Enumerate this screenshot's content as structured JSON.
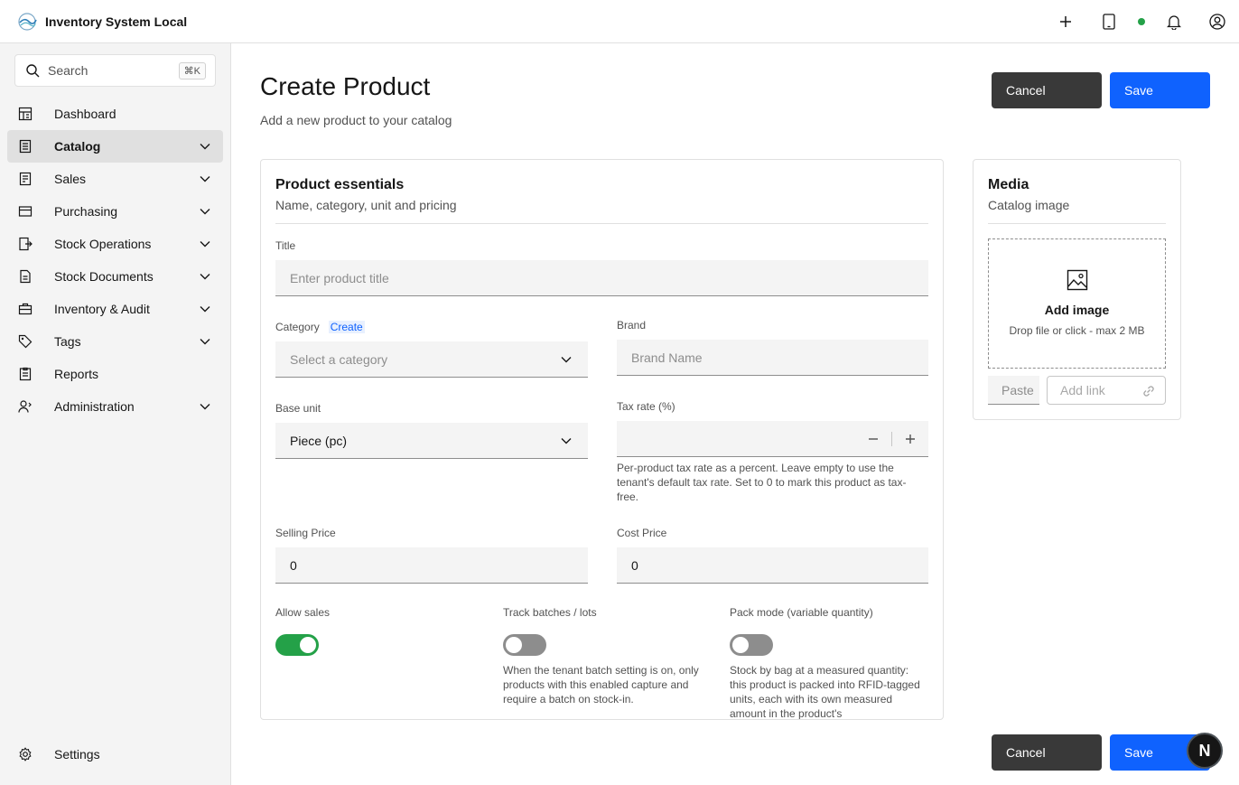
{
  "app": {
    "title": "Inventory System Local"
  },
  "search": {
    "label": "Search",
    "shortcut": "⌘K"
  },
  "sidebar": {
    "items": [
      {
        "label": "Dashboard",
        "icon": "dashboard-icon"
      },
      {
        "label": "Catalog",
        "icon": "catalog-icon",
        "active": true
      },
      {
        "label": "Sales",
        "icon": "receipt-icon"
      },
      {
        "label": "Purchasing",
        "icon": "card-icon"
      },
      {
        "label": "Stock Operations",
        "icon": "transfer-icon"
      },
      {
        "label": "Stock Documents",
        "icon": "document-icon"
      },
      {
        "label": "Inventory & Audit",
        "icon": "briefcase-icon"
      },
      {
        "label": "Tags",
        "icon": "tag-icon"
      },
      {
        "label": "Reports",
        "icon": "report-icon"
      },
      {
        "label": "Administration",
        "icon": "user-admin-icon"
      }
    ],
    "settings": "Settings"
  },
  "page": {
    "title": "Create Product",
    "subtitle": "Add a new product to your catalog",
    "cancel": "Cancel",
    "save": "Save"
  },
  "essentials": {
    "title": "Product essentials",
    "subtitle": "Name, category, unit and pricing",
    "title_label": "Title",
    "title_placeholder": "Enter product title",
    "category_label": "Category",
    "category_create": "Create",
    "category_placeholder": "Select a category",
    "brand_label": "Brand",
    "brand_placeholder": "Brand Name",
    "base_unit_label": "Base unit",
    "base_unit_value": "Piece (pc)",
    "tax_label": "Tax rate (%)",
    "tax_value": "",
    "tax_helper": "Per-product tax rate as a percent. Leave empty to use the tenant's default tax rate. Set to 0 to mark this product as tax-free.",
    "selling_label": "Selling Price",
    "selling_value": "0",
    "cost_label": "Cost Price",
    "cost_value": "0",
    "allow_sales_label": "Allow sales",
    "allow_sales_on": true,
    "batches_label": "Track batches / lots",
    "batches_on": false,
    "batches_helper": "When the tenant batch setting is on, only products with this enabled capture and require a batch on stock-in.",
    "pack_label": "Pack mode (variable quantity)",
    "pack_on": false,
    "pack_helper": "Stock by bag at a measured quantity: this product is packed into RFID-tagged units, each with its own measured amount in the product's"
  },
  "media": {
    "title": "Media",
    "subtitle": "Catalog image",
    "add_image": "Add image",
    "drop_hint": "Drop file or click - max 2 MB",
    "paste": "Paste",
    "add_link": "Add link"
  },
  "fab": {
    "label": "N"
  },
  "colors": {
    "primary": "#0f62fe",
    "success": "#24a148",
    "dark": "#393939"
  }
}
